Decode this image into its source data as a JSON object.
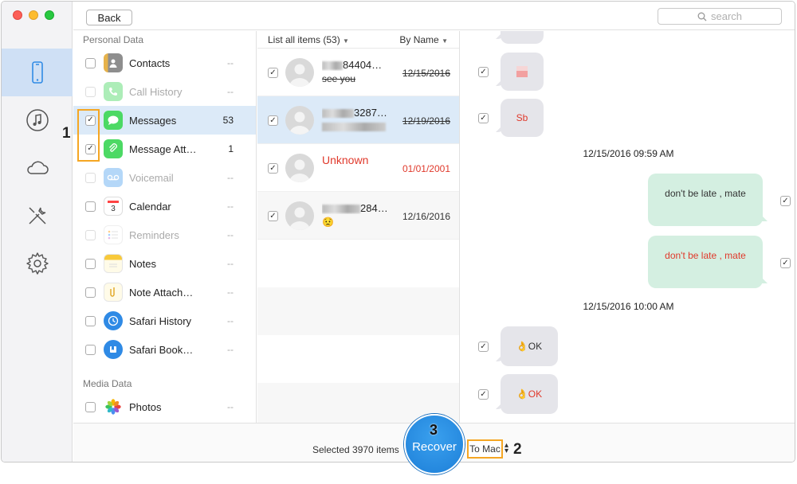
{
  "toolbar": {
    "back_label": "Back",
    "search_placeholder": "search"
  },
  "categories": {
    "personal_title": "Personal Data",
    "media_title": "Media Data",
    "items": [
      {
        "name": "Contacts",
        "count": "--",
        "checked": false,
        "dim": false
      },
      {
        "name": "Call History",
        "count": "--",
        "checked": false,
        "dim": true
      },
      {
        "name": "Messages",
        "count": "53",
        "checked": true,
        "dim": false
      },
      {
        "name": "Message Att…",
        "count": "1",
        "checked": true,
        "dim": false
      },
      {
        "name": "Voicemail",
        "count": "--",
        "checked": false,
        "dim": true
      },
      {
        "name": "Calendar",
        "count": "--",
        "checked": false,
        "dim": false
      },
      {
        "name": "Reminders",
        "count": "--",
        "checked": false,
        "dim": true
      },
      {
        "name": "Notes",
        "count": "--",
        "checked": false,
        "dim": false
      },
      {
        "name": "Note Attach…",
        "count": "--",
        "checked": false,
        "dim": false
      },
      {
        "name": "Safari History",
        "count": "--",
        "checked": false,
        "dim": false
      },
      {
        "name": "Safari Book…",
        "count": "--",
        "checked": false,
        "dim": false
      }
    ],
    "media_items": [
      {
        "name": "Photos",
        "count": "--",
        "checked": false,
        "dim": false
      }
    ]
  },
  "message_list": {
    "filter_label": "List all items (53)",
    "sort_label": "By Name",
    "rows": [
      {
        "title": "84404…",
        "sub": "see you",
        "date": "12/15/2016"
      },
      {
        "title": "3287…",
        "sub": "",
        "date": "12/19/2016"
      },
      {
        "title": "Unknown",
        "sub": "",
        "date": "01/01/2001"
      },
      {
        "title": "284…",
        "sub": "😟",
        "date": "12/16/2016"
      }
    ]
  },
  "conversation": {
    "bubble_sb": "Sb",
    "stamp1": "12/15/2016 09:59 AM",
    "out1": "don't be late , mate",
    "out2": "don't be late , mate",
    "stamp2": "12/15/2016 10:00 AM",
    "in_ok1": "👌OK",
    "in_ok2": "👌OK"
  },
  "bottom": {
    "selected_text": "Selected 3970 items",
    "recover_label": "Recover",
    "destination": "To Mac"
  },
  "callouts": {
    "one": "1",
    "two": "2",
    "three": "3"
  },
  "colors": {
    "accent": "#1d7fd8",
    "highlight": "#f5a623",
    "deleted_red": "#e0392b",
    "selection": "#dceaf8"
  }
}
